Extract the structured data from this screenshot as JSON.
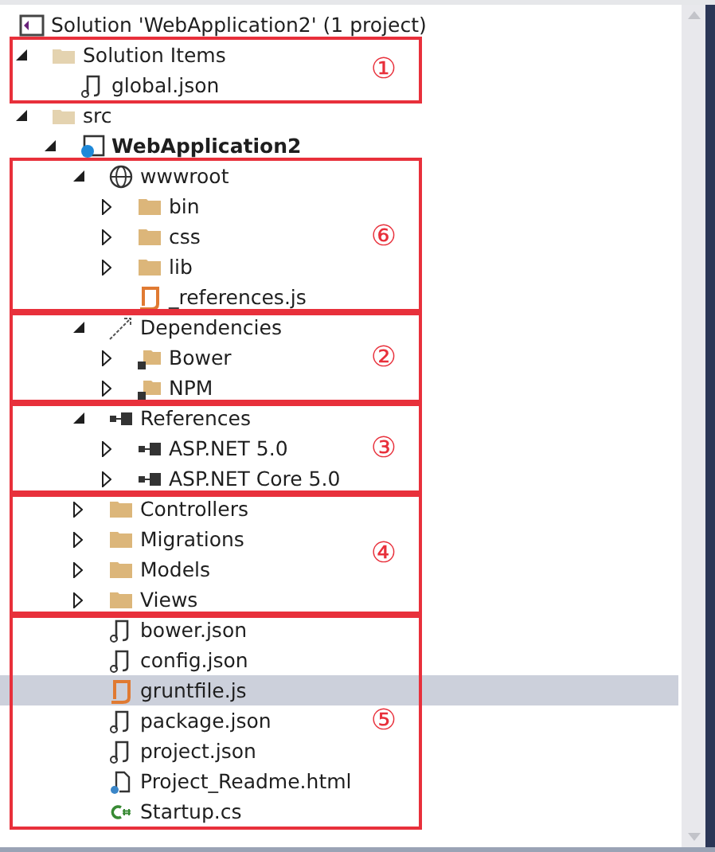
{
  "tree": [
    {
      "label": "Solution 'WebApplication2' (1 project)",
      "kind": "solution",
      "selected": false,
      "children": [
        {
          "label": "Solution Items",
          "kind": "folder-solution",
          "expanded": true,
          "selected": false,
          "children": [
            {
              "label": "global.json",
              "kind": "json",
              "selected": false
            }
          ]
        },
        {
          "label": "src",
          "kind": "folder-solution",
          "expanded": true,
          "selected": false,
          "children": [
            {
              "label": "WebApplication2",
              "kind": "project",
              "expanded": true,
              "selected": false,
              "children": [
                {
                  "label": "wwwroot",
                  "kind": "globe",
                  "expanded": true,
                  "selected": false,
                  "children": [
                    {
                      "label": "bin",
                      "kind": "folder",
                      "expanded": false,
                      "selected": false
                    },
                    {
                      "label": "css",
                      "kind": "folder",
                      "expanded": false,
                      "selected": false
                    },
                    {
                      "label": "lib",
                      "kind": "folder",
                      "expanded": false,
                      "selected": false
                    },
                    {
                      "label": "_references.js",
                      "kind": "js",
                      "selected": false
                    }
                  ]
                },
                {
                  "label": "Dependencies",
                  "kind": "dependencies",
                  "expanded": true,
                  "selected": false,
                  "children": [
                    {
                      "label": "Bower",
                      "kind": "package-folder",
                      "expanded": false,
                      "selected": false
                    },
                    {
                      "label": "NPM",
                      "kind": "package-folder",
                      "expanded": false,
                      "selected": false
                    }
                  ]
                },
                {
                  "label": "References",
                  "kind": "reference",
                  "expanded": true,
                  "selected": false,
                  "children": [
                    {
                      "label": "ASP.NET 5.0",
                      "kind": "reference",
                      "expanded": false,
                      "selected": false
                    },
                    {
                      "label": "ASP.NET Core 5.0",
                      "kind": "reference",
                      "expanded": false,
                      "selected": false
                    }
                  ]
                },
                {
                  "label": "Controllers",
                  "kind": "folder",
                  "expanded": false,
                  "selected": false
                },
                {
                  "label": "Migrations",
                  "kind": "folder",
                  "expanded": false,
                  "selected": false
                },
                {
                  "label": "Models",
                  "kind": "folder",
                  "expanded": false,
                  "selected": false
                },
                {
                  "label": "Views",
                  "kind": "folder",
                  "expanded": false,
                  "selected": false
                },
                {
                  "label": "bower.json",
                  "kind": "json",
                  "selected": false
                },
                {
                  "label": "config.json",
                  "kind": "json",
                  "selected": false
                },
                {
                  "label": "gruntfile.js",
                  "kind": "js",
                  "selected": true
                },
                {
                  "label": "package.json",
                  "kind": "json",
                  "selected": false
                },
                {
                  "label": "project.json",
                  "kind": "json",
                  "selected": false
                },
                {
                  "label": "Project_Readme.html",
                  "kind": "html",
                  "selected": false
                },
                {
                  "label": "Startup.cs",
                  "kind": "csharp",
                  "selected": false
                }
              ]
            }
          ]
        }
      ]
    }
  ],
  "annotations": [
    {
      "label": "①"
    },
    {
      "label": "⑥"
    },
    {
      "label": "②"
    },
    {
      "label": "③"
    },
    {
      "label": "④"
    },
    {
      "label": "⑤"
    }
  ]
}
